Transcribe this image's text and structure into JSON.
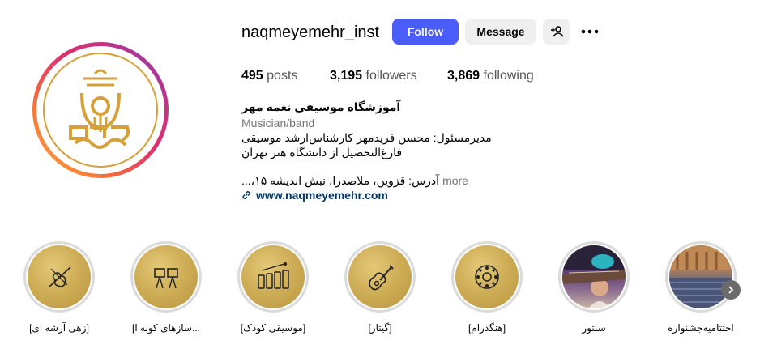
{
  "profile": {
    "username": "naqmeyemehr_inst",
    "follow_label": "Follow",
    "message_label": "Message",
    "stats": {
      "posts_count": "495",
      "posts_label": "posts",
      "followers_count": "3,195",
      "followers_label": "followers",
      "following_count": "3,869",
      "following_label": "following"
    },
    "bio": {
      "name": "آموزشگاه موسیقی نغمه مهر",
      "category": "Musician/band",
      "line1": "مدیرمسئول: محسن فریدمهر کارشناس‌ارشد موسیقی",
      "line2": "فارغ‌التحصیل از دانشگاه هنر تهران",
      "line3": "آدرس: قزوین، ملاصدرا، نبش اندیشه ۱۵،...",
      "more_label": "more",
      "link": "www.naqmeyemehr.com"
    }
  },
  "highlights": [
    {
      "label": "[زهی آرشه ای]",
      "icon": "violin-icon"
    },
    {
      "label": "[سازهای کوبه ا...",
      "icon": "drums-icon"
    },
    {
      "label": "[موسیقی کودک]",
      "icon": "xylophone-icon"
    },
    {
      "label": "[گیتار]",
      "icon": "guitar-icon"
    },
    {
      "label": "[هنگدرام]",
      "icon": "handpan-icon"
    },
    {
      "label": "سنتور",
      "icon": "santur-photo"
    },
    {
      "label": "اختتامیه‌جشنواره",
      "icon": "hall-photo"
    }
  ],
  "colors": {
    "accent": "#4a5df9",
    "gold": "#d4a13a",
    "link": "#00376b"
  }
}
